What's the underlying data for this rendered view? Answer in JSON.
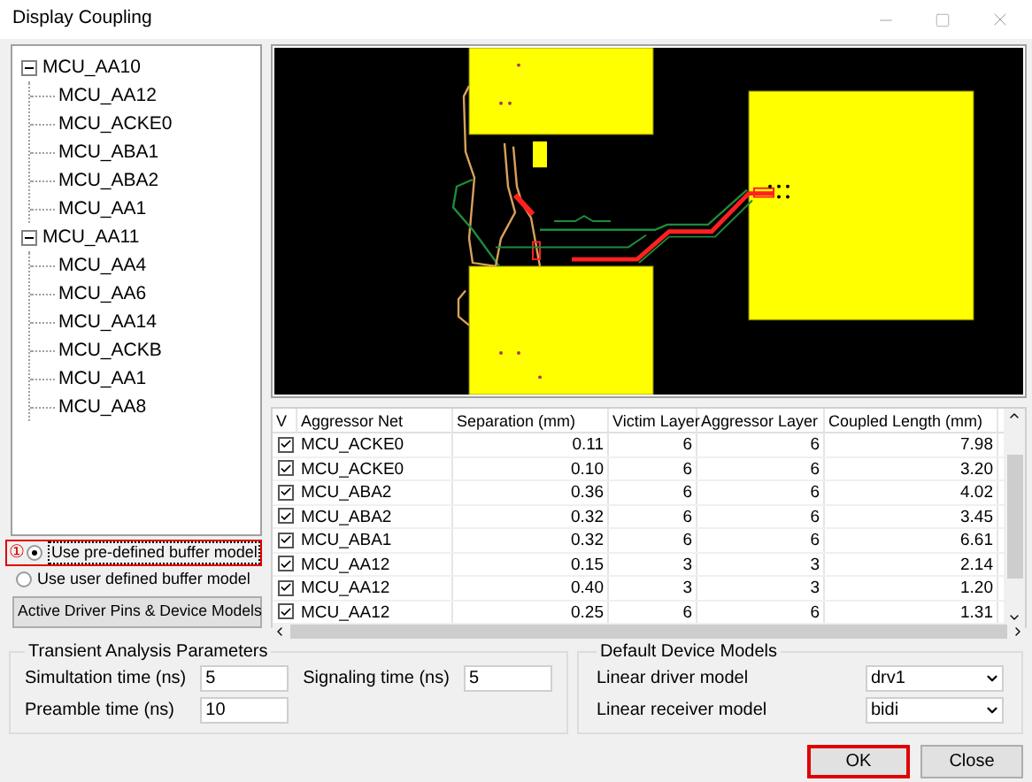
{
  "window": {
    "title": "Display Coupling"
  },
  "net_tree": [
    {
      "label": "MCU_AA10",
      "expanded": true,
      "children": [
        {
          "label": "MCU_AA12"
        },
        {
          "label": "MCU_ACKE0"
        },
        {
          "label": "MCU_ABA1"
        },
        {
          "label": "MCU_ABA2"
        },
        {
          "label": "MCU_AA1"
        }
      ]
    },
    {
      "label": "MCU_AA11",
      "expanded": true,
      "children": [
        {
          "label": "MCU_AA4"
        },
        {
          "label": "MCU_AA6"
        },
        {
          "label": "MCU_AA14"
        },
        {
          "label": "MCU_ACKB"
        },
        {
          "label": "MCU_AA1"
        },
        {
          "label": "MCU_AA8"
        }
      ]
    }
  ],
  "buffer_model": {
    "options": [
      {
        "label": "Use pre-defined buffer model",
        "selected": true,
        "highlighted": true,
        "marker": "①"
      },
      {
        "label": "Use user defined buffer model",
        "selected": false,
        "highlighted": false
      }
    ],
    "button": "Active Driver Pins & Device Models"
  },
  "table": {
    "check_column": "V",
    "columns": [
      "Aggressor Net",
      "Separation (mm)",
      "Victim Layer",
      "Aggressor Layer",
      "Coupled Length (mm)"
    ],
    "rows": [
      {
        "checked": true,
        "cells": [
          "MCU_ACKE0",
          "0.11",
          "6",
          "6",
          "7.98"
        ]
      },
      {
        "checked": true,
        "cells": [
          "MCU_ACKE0",
          "0.10",
          "6",
          "6",
          "3.20"
        ]
      },
      {
        "checked": true,
        "cells": [
          "MCU_ABA2",
          "0.36",
          "6",
          "6",
          "4.02"
        ]
      },
      {
        "checked": true,
        "cells": [
          "MCU_ABA2",
          "0.32",
          "6",
          "6",
          "3.45"
        ]
      },
      {
        "checked": true,
        "cells": [
          "MCU_ABA1",
          "0.32",
          "6",
          "6",
          "6.61"
        ]
      },
      {
        "checked": true,
        "cells": [
          "MCU_AA12",
          "0.15",
          "3",
          "3",
          "2.14"
        ]
      },
      {
        "checked": true,
        "cells": [
          "MCU_AA12",
          "0.40",
          "3",
          "3",
          "1.20"
        ]
      },
      {
        "checked": true,
        "cells": [
          "MCU_AA12",
          "0.25",
          "6",
          "6",
          "1.31"
        ]
      }
    ]
  },
  "transient": {
    "title": "Transient Analysis Parameters",
    "fields": [
      {
        "label": "Simultation time (ns)",
        "value": "5"
      },
      {
        "label": "Signaling time (ns)",
        "value": "5"
      },
      {
        "label": "Preamble time (ns)",
        "value": "10"
      }
    ]
  },
  "device_models": {
    "title": "Default Device Models",
    "fields": [
      {
        "label": "Linear driver model",
        "value": "drv1"
      },
      {
        "label": "Linear receiver model",
        "value": "bidi"
      }
    ]
  },
  "buttons": [
    {
      "label": "OK",
      "highlighted": true
    },
    {
      "label": "Close",
      "highlighted": false
    }
  ]
}
